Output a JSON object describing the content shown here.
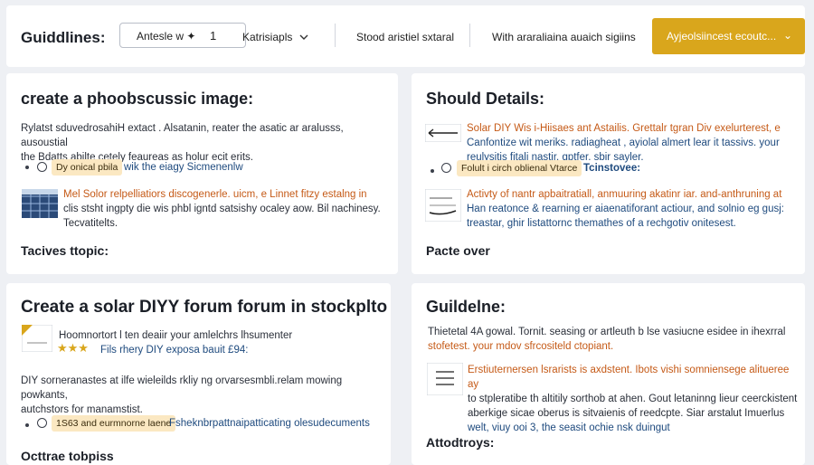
{
  "header": {
    "brand": "Guiddlines:",
    "stepper_label": "Antesle w ✦",
    "stepper_count": "1",
    "dropdown_label": "Katrisiapls",
    "text1": "Stood aristiel sxtaral",
    "text2": "With araraliaina auaich sigiins",
    "cta_label": "Ayjeolsiincest ecoutc...",
    "cta_chevron": "⌄"
  },
  "card1": {
    "title": "create a phoobscussic image:",
    "para": [
      "Rylatst sduvedrosahiH extact . Alsatanin, reater the asatic ar aralusss, ausoustial",
      "the Bdatts abilte cetely feaureas as holur ecit erits."
    ],
    "option_chip": "Dy onical pbila",
    "option_text": "wik the eiagy Sicmenenlw",
    "item_text": [
      "Mel Solor relpelliatiors discogenerle. uicm, e Linnet fitzy estalng in",
      "clis stsht ingpty die wis phbl igntd satsishy ocaley aow. Bil nachinesy.",
      "Tecvatitelts."
    ],
    "footer": "Tacives ttopic:"
  },
  "card2": {
    "title": "Should Details:",
    "para": [
      "Solar DIY Wis i-Hiisaes ant Astailis. Grettalr tgran Div exelurterest, e",
      "Canfontize wit meriks. radiagheat , ayiolal almert lear it tassivs. your",
      "reulysitis fitali nastir. gptfer. sbir sayler."
    ],
    "option_chip": "Folult i circh oblienal Vtarce",
    "option_text": "Tcinstovee:",
    "item_text": [
      "Activty of nantr apbaitratiall, anmuuring akatinr iar. and-anthruning at",
      "Han reatonce & rearning er aiaenatiforant actiour, and solnio eg gusj:",
      "treastar, ghir listattornc themathes of a rechgotiv onitesest."
    ],
    "footer": "Pacte over"
  },
  "card3": {
    "title": "Create a solar DIYY forum forum in stockplto",
    "review_line": "Hoomnortort l ten deaiir your amlelchrs lhsumenter",
    "stars": "★★★",
    "review_sub": "Fils rhery DIY exposa bauit £94:",
    "para": [
      "DIY sorneranastes at ilfe wieleilds rkliy ng orvarsesmbli.relam mowing powkants,",
      "autchstors for manamstist."
    ],
    "option_chip": "1S63 and eurmnorne laene",
    "option_text": "Fsheknbrpattnaipatticating olesudecuments",
    "footer": "Octtrae tobpiss"
  },
  "card4": {
    "title": "Guildelne:",
    "para": [
      "Thietetal 4A gowal. Tornit. seasing or artleuth b lse vasiucne esidee in ihexrral",
      "stofetest. your mdov sfrcositeld ctopiant."
    ],
    "item_text": [
      "Erstiuternersen lsrarists is axdstent. Ibots vishi somniensege alitueree ay",
      "to stpleratibe th altitily sorthob at ahen. Gout letaninng lieur ceerckistent",
      "aberkige sicae oberus is sitvaienis of reedcpte. Siar arstalut Imuerlus",
      "welt, viuy ooi 3, the seasit ochie nsk duingut"
    ],
    "footer": "Attodtroys:"
  }
}
